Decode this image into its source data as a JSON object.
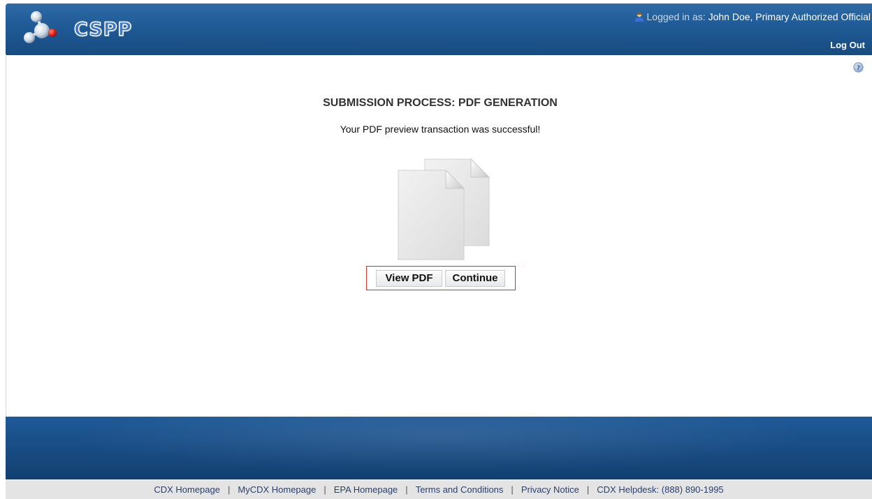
{
  "header": {
    "logo_text": "CSPP",
    "logged_in_prefix": "Logged in as:",
    "user_name": "John Doe, Primary Authorized Official",
    "logout_label": "Log Out"
  },
  "main": {
    "title": "SUBMISSION PROCESS: PDF GENERATION",
    "message": "Your PDF preview transaction was successful!",
    "view_pdf_label": "View PDF",
    "continue_label": "Continue"
  },
  "footer": {
    "links": [
      "CDX Homepage",
      "MyCDX Homepage",
      "EPA Homepage",
      "Terms and Conditions",
      "Privacy Notice",
      "CDX Helpdesk: (888) 890-1995"
    ],
    "separator": "|"
  },
  "icons": {
    "logo": "molecule-logo-icon",
    "user": "user-icon",
    "help": "help-icon",
    "document": "document-copy-icon"
  },
  "colors": {
    "header_blue": "#1f5a96",
    "footer_blue": "#1a4f88",
    "highlight_red": "#d9312b",
    "footer_link": "#2a3f6c"
  }
}
